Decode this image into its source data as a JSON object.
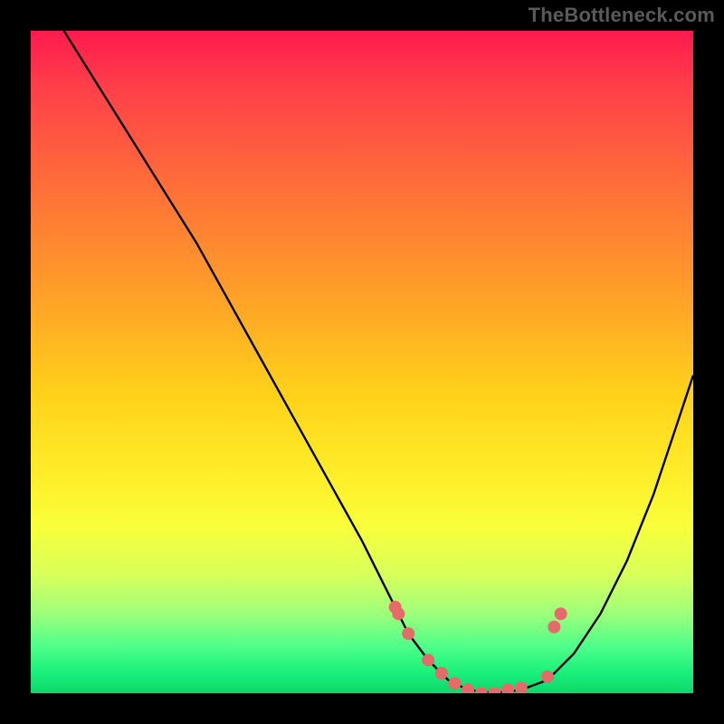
{
  "watermark": "TheBottleneck.com",
  "chart_data": {
    "type": "line",
    "title": "",
    "xlabel": "",
    "ylabel": "",
    "xlim": [
      0,
      100
    ],
    "ylim": [
      0,
      100
    ],
    "series": [
      {
        "name": "curve",
        "x": [
          5,
          10,
          15,
          20,
          25,
          30,
          35,
          40,
          45,
          50,
          55,
          57,
          60,
          63,
          66,
          70,
          74,
          78,
          82,
          86,
          90,
          94,
          98,
          100
        ],
        "y": [
          100,
          92,
          84,
          76,
          68,
          59,
          50,
          41,
          32,
          23,
          13,
          9,
          5,
          2,
          0.5,
          0,
          0.5,
          2,
          6,
          12,
          20,
          30,
          42,
          48
        ]
      }
    ],
    "markers": {
      "name": "highlight-points",
      "color": "#e66a6a",
      "x": [
        55,
        55.5,
        57,
        60,
        62,
        64,
        66,
        68,
        70,
        72,
        74,
        78,
        79,
        80
      ],
      "y": [
        13,
        12,
        9,
        5,
        3,
        1.5,
        0.5,
        0,
        0,
        0.5,
        0.8,
        2.5,
        10,
        12
      ]
    },
    "gradient_stops": [
      {
        "pos": 0,
        "color": "#ff1a4d"
      },
      {
        "pos": 22,
        "color": "#ff6a3a"
      },
      {
        "pos": 55,
        "color": "#ffd21a"
      },
      {
        "pos": 75,
        "color": "#f7ff3a"
      },
      {
        "pos": 93,
        "color": "#4dff8a"
      },
      {
        "pos": 100,
        "color": "#0fd66a"
      }
    ]
  }
}
